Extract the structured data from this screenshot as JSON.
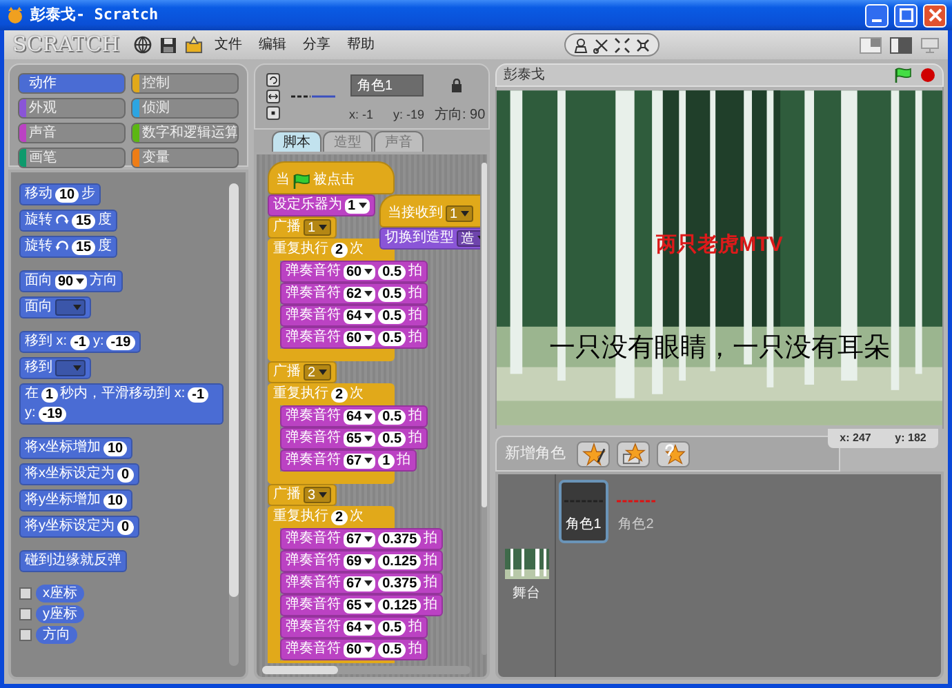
{
  "window": {
    "title": "彭泰戈- Scratch"
  },
  "logo": "SCRATCH",
  "menu": [
    "文件",
    "编辑",
    "分享",
    "帮助"
  ],
  "categories": [
    {
      "label": "动作",
      "color": "#4a6cd4",
      "selected": true
    },
    {
      "label": "控制",
      "color": "#e1a91a",
      "selected": false
    },
    {
      "label": "外观",
      "color": "#8a55d7",
      "selected": false
    },
    {
      "label": "侦测",
      "color": "#2ca5e2",
      "selected": false
    },
    {
      "label": "声音",
      "color": "#bb42c3",
      "selected": false
    },
    {
      "label": "数字和逻辑运算",
      "color": "#5cb712",
      "selected": false
    },
    {
      "label": "画笔",
      "color": "#0e9a6c",
      "selected": false
    },
    {
      "label": "变量",
      "color": "#ee7d16",
      "selected": false
    }
  ],
  "palette": [
    [
      {
        "kind": "stack",
        "parts": [
          {
            "kind": "label",
            "text": "移动"
          },
          {
            "kind": "number",
            "text": "10"
          },
          {
            "kind": "label",
            "text": "步"
          }
        ]
      },
      {
        "kind": "stack",
        "parts": [
          {
            "kind": "label",
            "text": "旋转"
          },
          {
            "kind": "clockwise"
          },
          {
            "kind": "number",
            "text": "15"
          },
          {
            "kind": "label",
            "text": "度"
          }
        ]
      },
      {
        "kind": "stack",
        "parts": [
          {
            "kind": "label",
            "text": "旋转"
          },
          {
            "kind": "counterclockwise"
          },
          {
            "kind": "number",
            "text": "15"
          },
          {
            "kind": "label",
            "text": "度"
          }
        ]
      }
    ],
    [
      {
        "kind": "stack",
        "parts": [
          {
            "kind": "label",
            "text": "面向"
          },
          {
            "kind": "menu",
            "text": "90"
          },
          {
            "kind": "label",
            "text": "方向"
          }
        ]
      },
      {
        "kind": "stack",
        "parts": [
          {
            "kind": "label",
            "text": "面向"
          },
          {
            "kind": "slot"
          }
        ]
      }
    ],
    [
      {
        "kind": "stack",
        "parts": [
          {
            "kind": "label",
            "text": "移到 x:"
          },
          {
            "kind": "number",
            "text": "-1"
          },
          {
            "kind": "label",
            "text": "y:"
          },
          {
            "kind": "number",
            "text": "-19"
          }
        ]
      },
      {
        "kind": "stack",
        "parts": [
          {
            "kind": "label",
            "text": "移到"
          },
          {
            "kind": "slot"
          }
        ]
      },
      {
        "kind": "stack",
        "parts": [
          {
            "kind": "label",
            "text": "在"
          },
          {
            "kind": "number",
            "text": "1"
          },
          {
            "kind": "label",
            "text": "秒内，平滑移动到 x:"
          },
          {
            "kind": "number",
            "text": "-1"
          },
          {
            "kind": "label",
            "text": "y:"
          },
          {
            "kind": "number",
            "text": "-19"
          }
        ]
      }
    ],
    [
      {
        "kind": "stack",
        "parts": [
          {
            "kind": "label",
            "text": "将x坐标增加"
          },
          {
            "kind": "number",
            "text": "10"
          }
        ]
      },
      {
        "kind": "stack",
        "parts": [
          {
            "kind": "label",
            "text": "将x坐标设定为"
          },
          {
            "kind": "number",
            "text": "0"
          }
        ]
      },
      {
        "kind": "stack",
        "parts": [
          {
            "kind": "label",
            "text": "将y坐标增加"
          },
          {
            "kind": "number",
            "text": "10"
          }
        ]
      },
      {
        "kind": "stack",
        "parts": [
          {
            "kind": "label",
            "text": "将y坐标设定为"
          },
          {
            "kind": "number",
            "text": "0"
          }
        ]
      }
    ],
    [
      {
        "kind": "stack",
        "parts": [
          {
            "kind": "label",
            "text": "碰到边缘就反弹"
          }
        ]
      }
    ],
    [
      {
        "kind": "reporter",
        "checked": false,
        "text": "x座标"
      },
      {
        "kind": "reporter",
        "checked": false,
        "text": "y座标"
      },
      {
        "kind": "reporter",
        "checked": false,
        "text": "方向"
      }
    ]
  ],
  "sprite": {
    "name": "角色1",
    "x": "x: -1",
    "y": "y: -19",
    "direction": "方向: 90"
  },
  "tabs": [
    {
      "label": "脚本",
      "selected": true
    },
    {
      "label": "造型",
      "selected": false
    },
    {
      "label": "声音",
      "selected": false
    }
  ],
  "scripts": [
    [
      {
        "kind": "hat",
        "color": "#e1a91a",
        "parts": [
          {
            "kind": "label",
            "text": "当"
          },
          {
            "kind": "flag"
          },
          {
            "kind": "label",
            "text": "被点击"
          }
        ]
      },
      {
        "kind": "stack",
        "color": "#bb42c3",
        "parts": [
          {
            "kind": "label",
            "text": "设定乐器为"
          },
          {
            "kind": "menu",
            "text": "1"
          }
        ]
      },
      {
        "kind": "stack",
        "color": "#e1a91a",
        "parts": [
          {
            "kind": "label",
            "text": "广播"
          },
          {
            "kind": "slot",
            "text": "1"
          }
        ]
      },
      {
        "kind": "c",
        "color": "#e1a91a",
        "parts": [
          {
            "kind": "label",
            "text": "重复执行"
          },
          {
            "kind": "number",
            "text": "2"
          },
          {
            "kind": "label",
            "text": "次"
          }
        ],
        "children": [
          {
            "kind": "stack",
            "color": "#bb42c3",
            "parts": [
              {
                "kind": "label",
                "text": "弹奏音符"
              },
              {
                "kind": "menu",
                "text": "60"
              },
              {
                "kind": "number",
                "text": "0.5"
              },
              {
                "kind": "label",
                "text": "拍"
              }
            ]
          },
          {
            "kind": "stack",
            "color": "#bb42c3",
            "parts": [
              {
                "kind": "label",
                "text": "弹奏音符"
              },
              {
                "kind": "menu",
                "text": "62"
              },
              {
                "kind": "number",
                "text": "0.5"
              },
              {
                "kind": "label",
                "text": "拍"
              }
            ]
          },
          {
            "kind": "stack",
            "color": "#bb42c3",
            "parts": [
              {
                "kind": "label",
                "text": "弹奏音符"
              },
              {
                "kind": "menu",
                "text": "64"
              },
              {
                "kind": "number",
                "text": "0.5"
              },
              {
                "kind": "label",
                "text": "拍"
              }
            ]
          },
          {
            "kind": "stack",
            "color": "#bb42c3",
            "parts": [
              {
                "kind": "label",
                "text": "弹奏音符"
              },
              {
                "kind": "menu",
                "text": "60"
              },
              {
                "kind": "number",
                "text": "0.5"
              },
              {
                "kind": "label",
                "text": "拍"
              }
            ]
          }
        ]
      },
      {
        "kind": "stack",
        "color": "#e1a91a",
        "parts": [
          {
            "kind": "label",
            "text": "广播"
          },
          {
            "kind": "slot",
            "text": "2"
          }
        ]
      },
      {
        "kind": "c",
        "color": "#e1a91a",
        "parts": [
          {
            "kind": "label",
            "text": "重复执行"
          },
          {
            "kind": "number",
            "text": "2"
          },
          {
            "kind": "label",
            "text": "次"
          }
        ],
        "children": [
          {
            "kind": "stack",
            "color": "#bb42c3",
            "parts": [
              {
                "kind": "label",
                "text": "弹奏音符"
              },
              {
                "kind": "menu",
                "text": "64"
              },
              {
                "kind": "number",
                "text": "0.5"
              },
              {
                "kind": "label",
                "text": "拍"
              }
            ]
          },
          {
            "kind": "stack",
            "color": "#bb42c3",
            "parts": [
              {
                "kind": "label",
                "text": "弹奏音符"
              },
              {
                "kind": "menu",
                "text": "65"
              },
              {
                "kind": "number",
                "text": "0.5"
              },
              {
                "kind": "label",
                "text": "拍"
              }
            ]
          },
          {
            "kind": "stack",
            "color": "#bb42c3",
            "parts": [
              {
                "kind": "label",
                "text": "弹奏音符"
              },
              {
                "kind": "menu",
                "text": "67"
              },
              {
                "kind": "number",
                "text": "1"
              },
              {
                "kind": "label",
                "text": "拍"
              }
            ]
          }
        ]
      },
      {
        "kind": "stack",
        "color": "#e1a91a",
        "parts": [
          {
            "kind": "label",
            "text": "广播"
          },
          {
            "kind": "slot",
            "text": "3"
          }
        ]
      },
      {
        "kind": "c",
        "color": "#e1a91a",
        "parts": [
          {
            "kind": "label",
            "text": "重复执行"
          },
          {
            "kind": "number",
            "text": "2"
          },
          {
            "kind": "label",
            "text": "次"
          }
        ],
        "children": [
          {
            "kind": "stack",
            "color": "#bb42c3",
            "parts": [
              {
                "kind": "label",
                "text": "弹奏音符"
              },
              {
                "kind": "menu",
                "text": "67"
              },
              {
                "kind": "number",
                "text": "0.375"
              },
              {
                "kind": "label",
                "text": "拍"
              }
            ]
          },
          {
            "kind": "stack",
            "color": "#bb42c3",
            "parts": [
              {
                "kind": "label",
                "text": "弹奏音符"
              },
              {
                "kind": "menu",
                "text": "69"
              },
              {
                "kind": "number",
                "text": "0.125"
              },
              {
                "kind": "label",
                "text": "拍"
              }
            ]
          },
          {
            "kind": "stack",
            "color": "#bb42c3",
            "parts": [
              {
                "kind": "label",
                "text": "弹奏音符"
              },
              {
                "kind": "menu",
                "text": "67"
              },
              {
                "kind": "number",
                "text": "0.375"
              },
              {
                "kind": "label",
                "text": "拍"
              }
            ]
          },
          {
            "kind": "stack",
            "color": "#bb42c3",
            "parts": [
              {
                "kind": "label",
                "text": "弹奏音符"
              },
              {
                "kind": "menu",
                "text": "65"
              },
              {
                "kind": "number",
                "text": "0.125"
              },
              {
                "kind": "label",
                "text": "拍"
              }
            ]
          },
          {
            "kind": "stack",
            "color": "#bb42c3",
            "parts": [
              {
                "kind": "label",
                "text": "弹奏音符"
              },
              {
                "kind": "menu",
                "text": "64"
              },
              {
                "kind": "number",
                "text": "0.5"
              },
              {
                "kind": "label",
                "text": "拍"
              }
            ]
          },
          {
            "kind": "stack",
            "color": "#bb42c3",
            "parts": [
              {
                "kind": "label",
                "text": "弹奏音符"
              },
              {
                "kind": "menu",
                "text": "60"
              },
              {
                "kind": "number",
                "text": "0.5"
              },
              {
                "kind": "label",
                "text": "拍"
              }
            ]
          }
        ]
      }
    ],
    [
      {
        "kind": "hat",
        "color": "#e1a91a",
        "parts": [
          {
            "kind": "label",
            "text": "当接收到"
          },
          {
            "kind": "slot",
            "text": "1"
          }
        ]
      },
      {
        "kind": "stack",
        "color": "#8a55d7",
        "parts": [
          {
            "kind": "label",
            "text": "切换到造型"
          },
          {
            "kind": "slot",
            "text": "造"
          }
        ]
      }
    ]
  ],
  "stage": {
    "title": "彭泰戈",
    "texts": [
      {
        "kind": "title",
        "text": "两只老虎MTV"
      },
      {
        "kind": "lyric",
        "text": "一只没有眼睛，一只没有耳朵"
      }
    ],
    "mouse_x": "x: 247",
    "mouse_y": "y: 182"
  },
  "new_sprite": "新增角色",
  "stage_item": "舞台",
  "sprites": [
    {
      "name": "角色1",
      "color": "#222222",
      "selected": true
    },
    {
      "name": "角色2",
      "color": "#dd1111",
      "selected": false
    }
  ]
}
